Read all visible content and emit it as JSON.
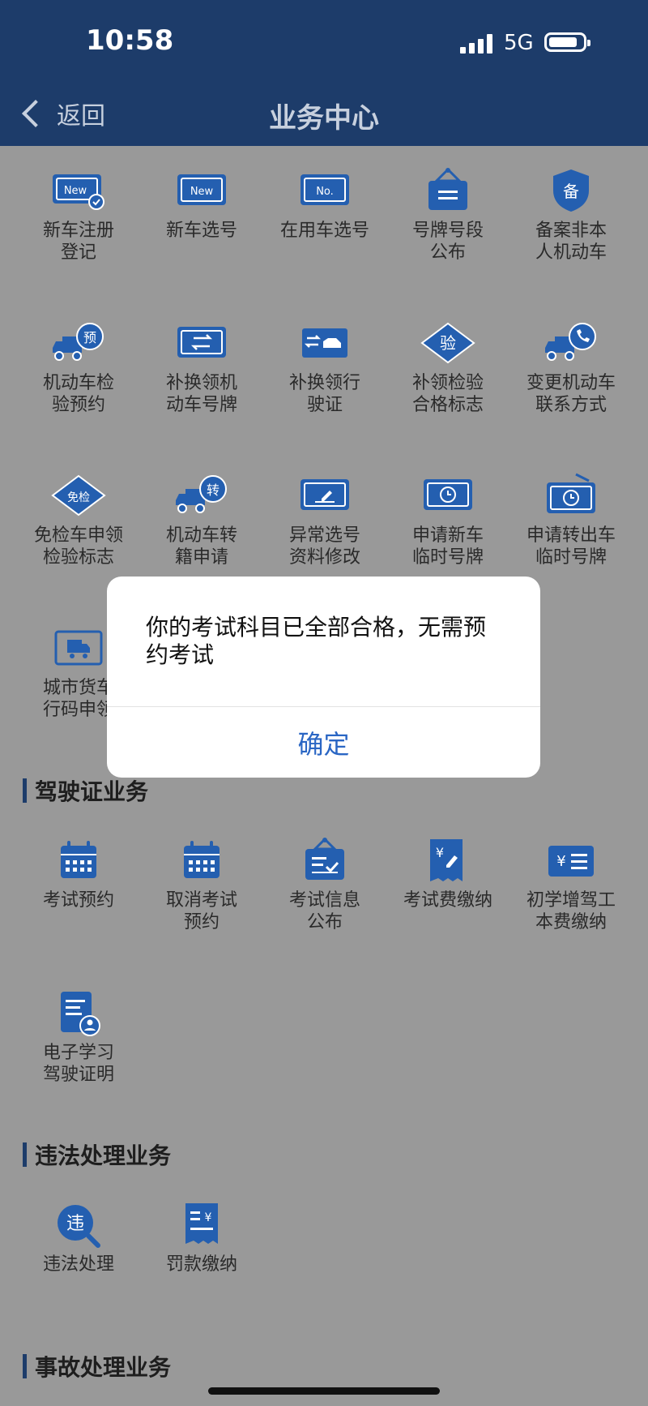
{
  "status": {
    "time": "10:58",
    "network": "5G"
  },
  "header": {
    "back_label": "返回",
    "title": "业务中心"
  },
  "vehicle_items": [
    {
      "label": "新车注册\n登记",
      "icon": "new-plate-check-icon"
    },
    {
      "label": "新车选号",
      "icon": "new-plate-icon"
    },
    {
      "label": "在用车选号",
      "icon": "no-plate-icon"
    },
    {
      "label": "号牌号段\n公布",
      "icon": "hanging-board-icon"
    },
    {
      "label": "备案非本\n人机动车",
      "icon": "shield-badge-icon",
      "glyph": "备"
    },
    {
      "label": "机动车检\n验预约",
      "icon": "truck-reserve-icon",
      "glyph": "预"
    },
    {
      "label": "补换领机\n动车号牌",
      "icon": "plate-swap-icon"
    },
    {
      "label": "补换领行\n驶证",
      "icon": "license-swap-icon"
    },
    {
      "label": "补领检验\n合格标志",
      "icon": "diamond-inspect-icon",
      "glyph": "验"
    },
    {
      "label": "变更机动车\n联系方式",
      "icon": "truck-phone-icon"
    },
    {
      "label": "免检车申领\n检验标志",
      "icon": "diamond-exempt-icon",
      "glyph": "免检"
    },
    {
      "label": "机动车转\n籍申请",
      "icon": "truck-transfer-icon",
      "glyph": "转"
    },
    {
      "label": "异常选号\n资料修改",
      "icon": "plate-edit-icon"
    },
    {
      "label": "申请新车\n临时号牌",
      "icon": "temp-plate-icon"
    },
    {
      "label": "申请转出车\n临时号牌",
      "icon": "temp-plate-radio-icon"
    },
    {
      "label": "城市货车\n行码申领",
      "icon": "city-truck-icon"
    }
  ],
  "sections": {
    "license": "驾驶证业务",
    "violation": "违法处理业务",
    "accident": "事故处理业务"
  },
  "license_items": [
    {
      "label": "考试预约",
      "icon": "calendar-icon"
    },
    {
      "label": "取消考试\n预约",
      "icon": "calendar-cancel-icon"
    },
    {
      "label": "考试信息\n公布",
      "icon": "info-board-icon"
    },
    {
      "label": "考试费缴纳",
      "icon": "yuan-receipt-icon"
    },
    {
      "label": "初学增驾工\n本费缴纳",
      "icon": "yuan-card-icon"
    },
    {
      "label": "电子学习\n驾驶证明",
      "icon": "document-user-icon"
    }
  ],
  "violation_items": [
    {
      "label": "违法处理",
      "icon": "magnifier-violation-icon",
      "glyph": "违"
    },
    {
      "label": "罚款缴纳",
      "icon": "fine-receipt-icon"
    }
  ],
  "dialog": {
    "message": "你的考试科目已全部合格，无需预约考试",
    "confirm_label": "确定"
  },
  "colors": {
    "icon_blue": "#245fb0",
    "header_navy": "#1d3c6a",
    "dim_overlay": "#999999",
    "dialog_button": "#2a66c4"
  }
}
